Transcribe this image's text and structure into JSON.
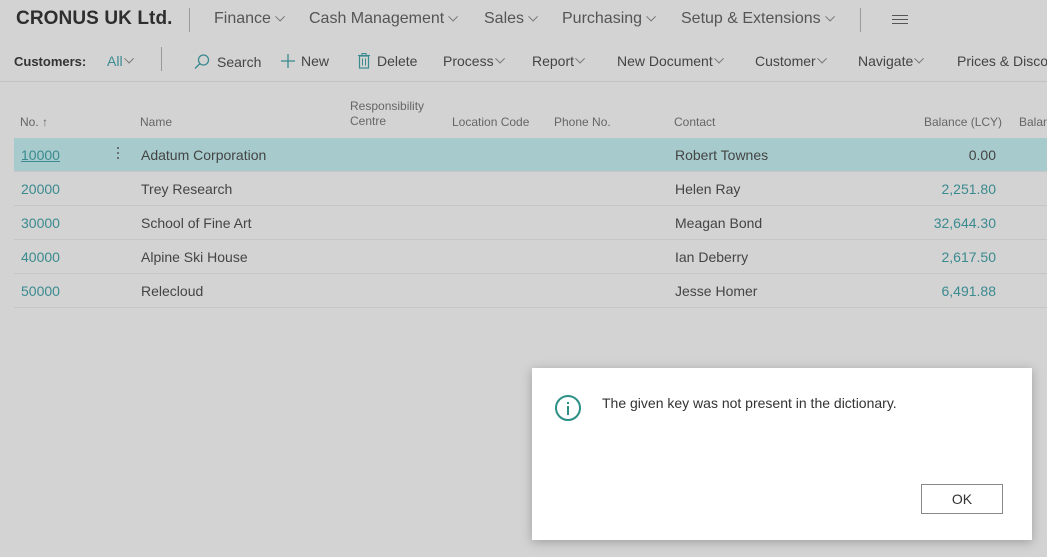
{
  "app": {
    "company": "CRONUS UK Ltd."
  },
  "topnav": [
    "Finance",
    "Cash Management",
    "Sales",
    "Purchasing",
    "Setup & Extensions"
  ],
  "actions": {
    "page_label": "Customers:",
    "filter": "All",
    "search": "Search",
    "new": "New",
    "delete": "Delete",
    "process": "Process",
    "report": "Report",
    "new_document": "New Document",
    "customer": "Customer",
    "navigate": "Navigate",
    "prices": "Prices & Discou"
  },
  "table": {
    "headers": {
      "no": "No. ↑",
      "name": "Name",
      "resp_line1": "Responsibility",
      "resp_line2": "Centre",
      "location": "Location Code",
      "phone": "Phone No.",
      "contact": "Contact",
      "balance": "Balance (LCY)",
      "balance_due": "Balan"
    },
    "rows": [
      {
        "no": "10000",
        "name": "Adatum Corporation",
        "contact": "Robert Townes",
        "balance": "0.00"
      },
      {
        "no": "20000",
        "name": "Trey Research",
        "contact": "Helen Ray",
        "balance": "2,251.80"
      },
      {
        "no": "30000",
        "name": "School of Fine Art",
        "contact": "Meagan Bond",
        "balance": "32,644.30"
      },
      {
        "no": "40000",
        "name": "Alpine Ski House",
        "contact": "Ian Deberry",
        "balance": "2,617.50"
      },
      {
        "no": "50000",
        "name": "Relecloud",
        "contact": "Jesse Homer",
        "balance": "6,491.88"
      }
    ]
  },
  "dialog": {
    "message": "The given key was not present in the dictionary.",
    "ok": "OK"
  },
  "colors": {
    "accent": "#3a8a8f",
    "selected_row": "#a7cbcc",
    "info_icon": "#2c8f86"
  }
}
